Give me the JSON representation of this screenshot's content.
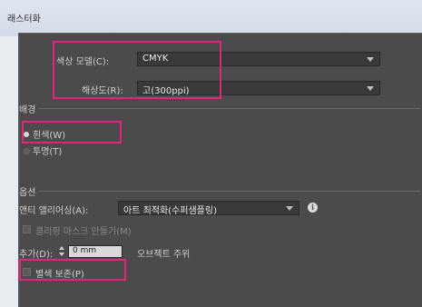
{
  "window": {
    "title": "래스터화"
  },
  "color_model": {
    "label": "색상 모델(C):",
    "value": "CMYK"
  },
  "resolution": {
    "label": "해상도(R):",
    "value": "고(300ppi)"
  },
  "background": {
    "section_label": "배경",
    "options": [
      {
        "label": "흰색(W)",
        "selected": true
      },
      {
        "label": "투명(T)",
        "selected": false
      }
    ]
  },
  "options": {
    "section_label": "옵션",
    "anti_alias": {
      "label": "앤티 앨리어싱(A):",
      "value": "아트 최적화(수퍼샘플링)"
    },
    "clipping_mask": {
      "label": "클리핑 마스크 만들기(M)",
      "checked": false
    },
    "add_around": {
      "label": "추가(D):",
      "value": "0 mm",
      "suffix": "오브젝트 주위"
    },
    "preserve_spot": {
      "label": "별색 보존(P)",
      "checked": false
    }
  },
  "colors": {
    "highlight": "#e3257e",
    "panel": "#4b4b4b"
  }
}
